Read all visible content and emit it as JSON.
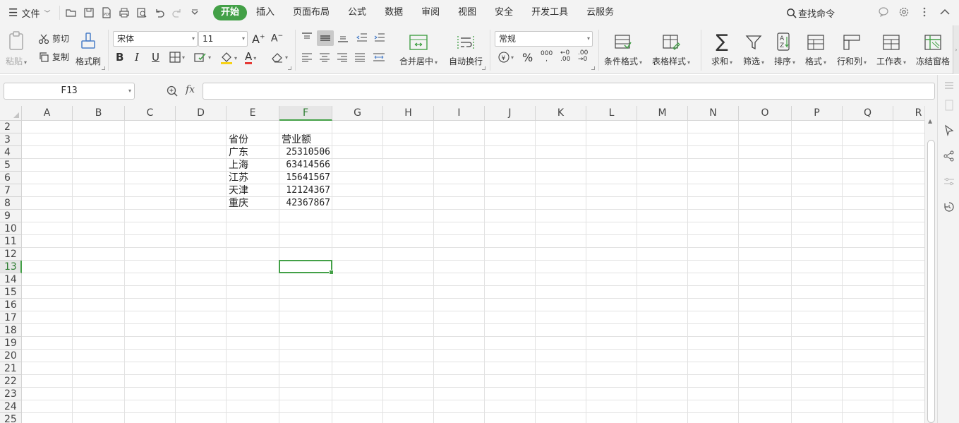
{
  "menu": {
    "file_label": "文件",
    "tabs": [
      "开始",
      "插入",
      "页面布局",
      "公式",
      "数据",
      "审阅",
      "视图",
      "安全",
      "开发工具",
      "云服务"
    ],
    "active_tab": "开始",
    "search_label": "查找命令"
  },
  "ribbon": {
    "paste": "粘贴",
    "cut": "剪切",
    "copy": "复制",
    "format_painter": "格式刷",
    "font_name": "宋体",
    "font_size": "11",
    "bold": "B",
    "italic": "I",
    "underline": "U",
    "font_color_letter": "A",
    "merge_center": "合并居中",
    "wrap_text": "自动换行",
    "number_format": "常规",
    "percent": "%",
    "thousands": "000",
    "inc_decimal": "+0\n.00",
    "dec_decimal": ".00\n→0",
    "cond_format": "条件格式",
    "table_style": "表格样式",
    "sum": "求和",
    "filter": "筛选",
    "sort": "排序",
    "format": "格式",
    "row_col": "行和列",
    "worksheet": "工作表",
    "freeze": "冻结窗格"
  },
  "formula_bar": {
    "name_box": "F13",
    "fx": "fx",
    "formula": ""
  },
  "grid": {
    "columns": [
      "A",
      "B",
      "C",
      "D",
      "E",
      "F",
      "G",
      "H",
      "I",
      "J",
      "K",
      "L",
      "M",
      "N",
      "O",
      "P",
      "Q",
      "R"
    ],
    "selected_column": "F",
    "rows": [
      "2",
      "3",
      "4",
      "5",
      "6",
      "7",
      "8",
      "9",
      "10",
      "11",
      "12",
      "13",
      "14",
      "15",
      "16",
      "17",
      "18",
      "19",
      "20",
      "21",
      "22",
      "23",
      "24",
      "25"
    ],
    "selected_row": "13",
    "selected_cell": "F13",
    "data": {
      "E3": "省份",
      "F3": "营业额",
      "E4": "广东",
      "F4": "25310506",
      "E5": "上海",
      "F5": "63414566",
      "E6": "江苏",
      "F6": "15641567",
      "E7": "天津",
      "F7": "12124367",
      "E8": "重庆",
      "F8": "42367867"
    }
  },
  "colors": {
    "accent": "#43a047",
    "ribbon_bg": "#f3f3f3",
    "grid_line": "#e2e2e2"
  }
}
